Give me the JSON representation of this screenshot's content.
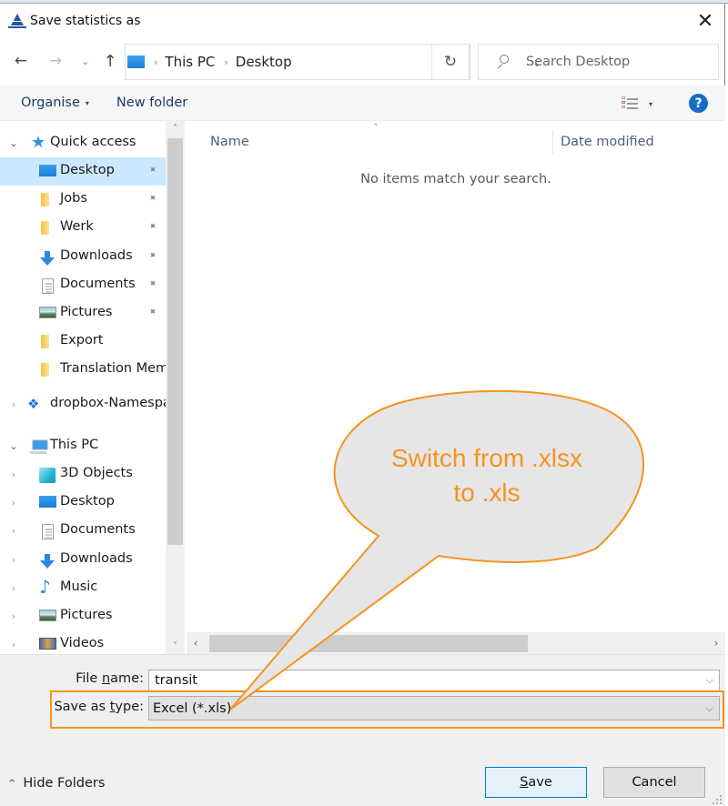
{
  "dialog": {
    "title": "Save statistics as",
    "close_glyph": "✕"
  },
  "nav": {
    "back_glyph": "←",
    "forward_glyph": "→",
    "recent_glyph": "⌄",
    "up_glyph": "↑",
    "breadcrumb": [
      "This PC",
      "Desktop"
    ],
    "crumb_separator": "›",
    "dropdown_glyph": "⌄",
    "refresh_glyph": "↻",
    "search_placeholder": "Search Desktop"
  },
  "toolbar": {
    "organise_label": "Organise",
    "new_folder_label": "New folder",
    "caret_glyph": "▾",
    "help_glyph": "?"
  },
  "navpane": {
    "items": [
      {
        "label": "Quick access",
        "icon": "star-icon",
        "chevron": "⌄",
        "level": 0
      },
      {
        "label": "Desktop",
        "icon": "desktop-icon",
        "pinned": true,
        "selected": true,
        "level": 1
      },
      {
        "label": "Jobs",
        "icon": "folder-icon",
        "pinned": true,
        "level": 1
      },
      {
        "label": "Werk",
        "icon": "folder-icon",
        "pinned": true,
        "level": 1
      },
      {
        "label": "Downloads",
        "icon": "download-icon",
        "pinned": true,
        "level": 1
      },
      {
        "label": "Documents",
        "icon": "documents-icon",
        "pinned": true,
        "level": 1
      },
      {
        "label": "Pictures",
        "icon": "pictures-icon",
        "pinned": true,
        "level": 1
      },
      {
        "label": "Export",
        "icon": "folder-icon",
        "level": 1
      },
      {
        "label": "Translation Memories",
        "icon": "folder-icon",
        "level": 1
      },
      {
        "label": "dropbox-Namespace",
        "icon": "dropbox-icon",
        "chevron": "›",
        "level": 0
      },
      {
        "label": "This PC",
        "icon": "computer-icon",
        "chevron": "⌄",
        "level": 0
      },
      {
        "label": "3D Objects",
        "icon": "3d-objects-icon",
        "chevron": "›",
        "level": 1
      },
      {
        "label": "Desktop",
        "icon": "desktop-icon",
        "chevron": "›",
        "level": 1
      },
      {
        "label": "Documents",
        "icon": "documents-icon",
        "chevron": "›",
        "level": 1
      },
      {
        "label": "Downloads",
        "icon": "download-icon",
        "chevron": "›",
        "level": 1
      },
      {
        "label": "Music",
        "icon": "music-icon",
        "chevron": "›",
        "level": 1
      },
      {
        "label": "Pictures",
        "icon": "pictures-icon",
        "chevron": "›",
        "level": 1
      },
      {
        "label": "Videos",
        "icon": "videos-icon",
        "chevron": "›",
        "level": 1
      }
    ],
    "pin_glyph": "📌",
    "scroll_up_glyph": "˄",
    "scroll_down_glyph": "˅"
  },
  "content": {
    "sort_glyph": "˄",
    "columns": [
      "Name",
      "Date modified"
    ],
    "empty_message": "No items match your search.",
    "hscroll_left_glyph": "‹",
    "hscroll_right_glyph": "›"
  },
  "form": {
    "filename_label_pre": "File ",
    "filename_label_ul": "n",
    "filename_label_post": "ame:",
    "filename_value": "transit",
    "type_label_pre": "Save as ",
    "type_label_ul": "t",
    "type_label_post": "ype:",
    "type_value": "Excel (*.xls)",
    "chevron_glyph": "⌵"
  },
  "footer": {
    "hide_folders_label": "Hide Folders",
    "hide_folders_glyph": "^",
    "save_ul": "S",
    "save_rest": "ave",
    "cancel_label": "Cancel"
  },
  "annotation": {
    "line1": "Switch from .xlsx",
    "line2": "to .xls",
    "color": "#f7931e",
    "fill": "#e6e6e6"
  }
}
